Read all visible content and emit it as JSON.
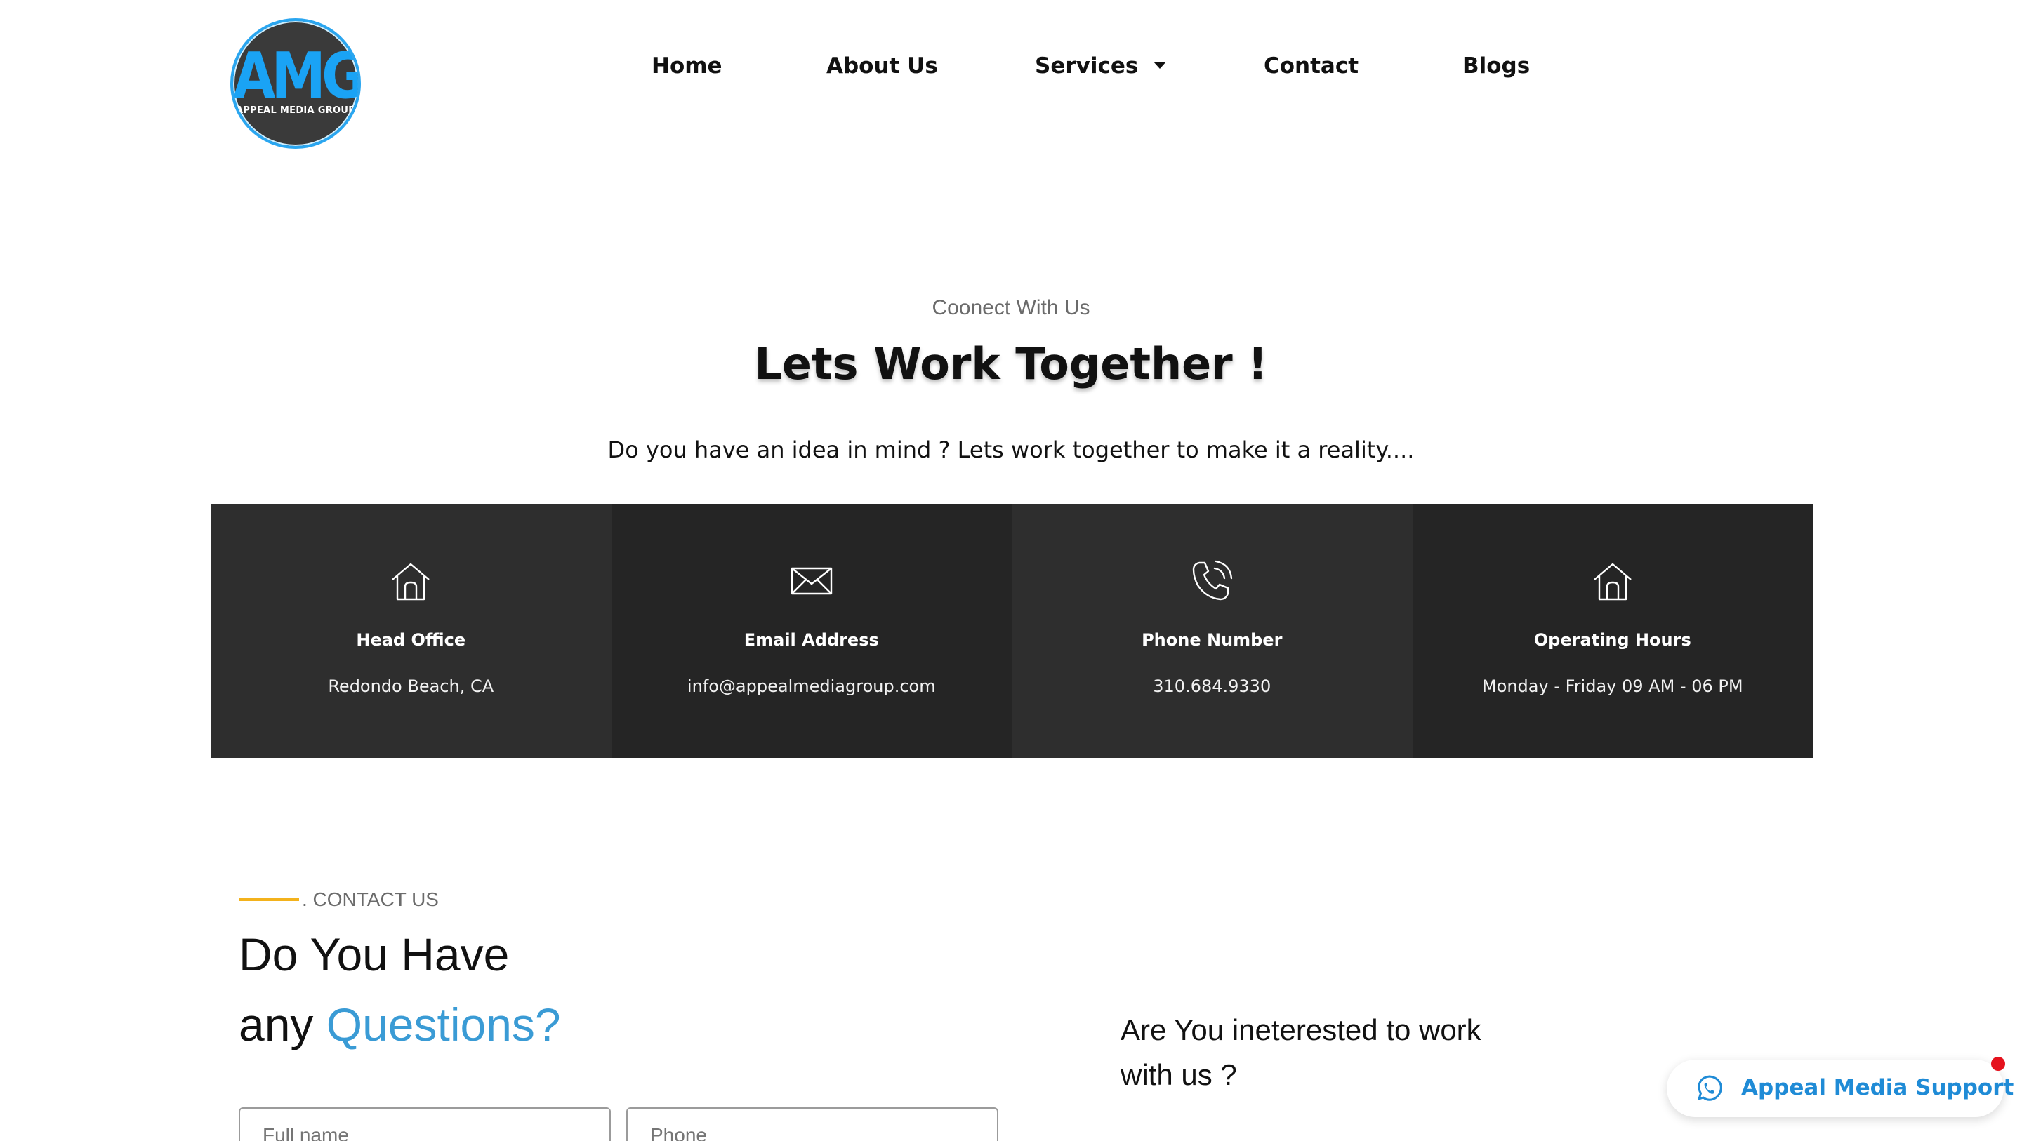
{
  "header": {
    "logo": {
      "text": "AMG",
      "subtitle": "APPEAL MEDIA GROUP"
    },
    "nav": [
      {
        "label": "Home"
      },
      {
        "label": "About Us"
      },
      {
        "label": "Services"
      },
      {
        "label": "Contact"
      },
      {
        "label": "Blogs"
      }
    ]
  },
  "connect": {
    "eyebrow": "Coonect With Us",
    "title": "Lets Work Together !",
    "lead": "Do you have an idea in mind ? Lets work together to make it a reality...."
  },
  "cards": [
    {
      "icon": "home-icon",
      "label": "Head Office",
      "value": "Redondo Beach, CA"
    },
    {
      "icon": "envelope-icon",
      "label": "Email Address",
      "value": "info@appealmediagroup.com"
    },
    {
      "icon": "phone-icon",
      "label": "Phone Number",
      "value": "310.684.9330"
    },
    {
      "icon": "home-icon",
      "label": "Operating Hours",
      "value": "Monday - Friday 09 AM - 06 PM"
    }
  ],
  "contact": {
    "eyebrow": ". CONTACT US",
    "heading_line1": "Do You Have",
    "heading_line2_prefix": "any ",
    "heading_line2_accent": "Questions?",
    "fields": {
      "fullname_placeholder": "Full name",
      "phone_placeholder": "Phone"
    },
    "side_line1": "Are You ineterested to work",
    "side_line2": "with us ?"
  },
  "support": {
    "label": "Appeal Media Support"
  },
  "colors": {
    "accent": "#3a9bd5",
    "eyebrow_bar": "#f3b21c",
    "card_dark": "#252525",
    "card_mid": "#2e2e2e",
    "support_text": "#1f8bd6",
    "notify_dot": "#e5121d"
  }
}
